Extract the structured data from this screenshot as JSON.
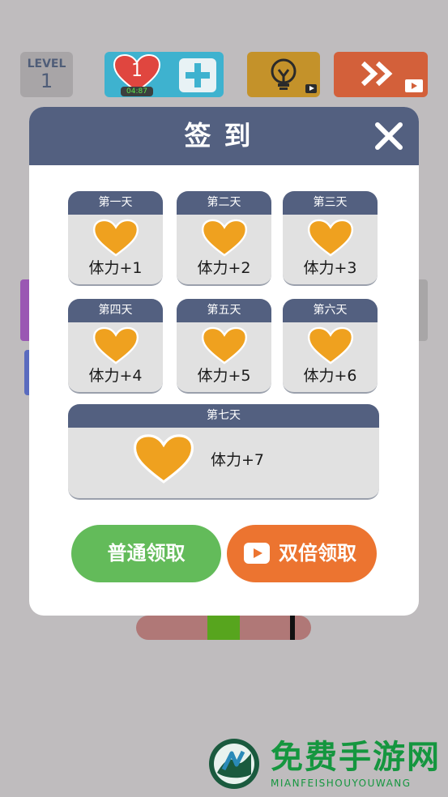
{
  "top_bar": {
    "level_label": "LEVEL",
    "level_value": "1",
    "lives_count": "1",
    "lives_timer": "04:87"
  },
  "dialog": {
    "title": "签到",
    "days": [
      {
        "label": "第一天",
        "reward": "体力+1"
      },
      {
        "label": "第二天",
        "reward": "体力+2"
      },
      {
        "label": "第三天",
        "reward": "体力+3"
      },
      {
        "label": "第四天",
        "reward": "体力+4"
      },
      {
        "label": "第五天",
        "reward": "体力+5"
      },
      {
        "label": "第六天",
        "reward": "体力+6"
      },
      {
        "label": "第七天",
        "reward": "体力+7"
      }
    ],
    "normal_claim_label": "普通领取",
    "double_claim_label": "双倍领取"
  },
  "watermark": {
    "title": "免费手游网",
    "subtitle": "MIANFEISHOUYOUWANG"
  },
  "colors": {
    "header": "#536080",
    "heart": "#efa11f",
    "green_button": "#63bb5a",
    "orange_button": "#ec7430"
  },
  "icons": [
    "heart-icon",
    "plus-icon",
    "lightbulb-icon",
    "fast-forward-icon",
    "video-icon",
    "close-icon",
    "play-icon"
  ]
}
